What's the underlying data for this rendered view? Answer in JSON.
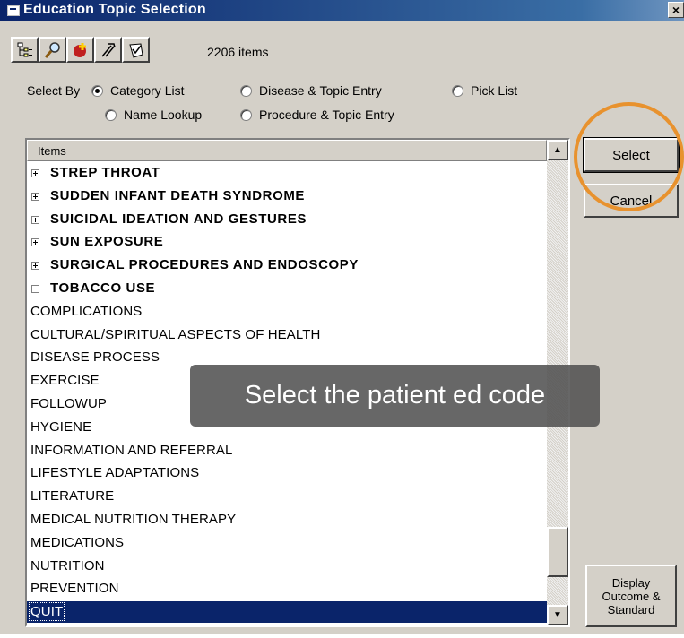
{
  "window": {
    "title": "Education Topic Selection",
    "close_label": "×"
  },
  "toolbar": {
    "buttons": [
      "tree-view-icon",
      "search-icon",
      "add-icon",
      "tools-icon",
      "checklist-icon"
    ],
    "item_count": "2206 items"
  },
  "select_by": {
    "label": "Select By",
    "options": [
      {
        "label": "Category List",
        "selected": true
      },
      {
        "label": "Disease & Topic Entry",
        "selected": false
      },
      {
        "label": "Pick List",
        "selected": false
      },
      {
        "label": "Name Lookup",
        "selected": false
      },
      {
        "label": "Procedure & Topic Entry",
        "selected": false
      }
    ]
  },
  "list": {
    "header": "Items",
    "rows": [
      {
        "label": "STREP THROAT",
        "type": "category",
        "expanded": false
      },
      {
        "label": "SUDDEN INFANT DEATH SYNDROME",
        "type": "category",
        "expanded": false
      },
      {
        "label": "SUICIDAL IDEATION AND GESTURES",
        "type": "category",
        "expanded": false
      },
      {
        "label": "SUN EXPOSURE",
        "type": "category",
        "expanded": false
      },
      {
        "label": "SURGICAL PROCEDURES AND ENDOSCOPY",
        "type": "category",
        "expanded": false
      },
      {
        "label": "TOBACCO USE",
        "type": "category",
        "expanded": true
      },
      {
        "label": "COMPLICATIONS",
        "type": "topic"
      },
      {
        "label": "CULTURAL/SPIRITUAL ASPECTS OF HEALTH",
        "type": "topic"
      },
      {
        "label": "DISEASE PROCESS",
        "type": "topic"
      },
      {
        "label": "EXERCISE",
        "type": "topic"
      },
      {
        "label": "FOLLOWUP",
        "type": "topic"
      },
      {
        "label": "HYGIENE",
        "type": "topic"
      },
      {
        "label": "INFORMATION AND REFERRAL",
        "type": "topic"
      },
      {
        "label": "LIFESTYLE ADAPTATIONS",
        "type": "topic"
      },
      {
        "label": "LITERATURE",
        "type": "topic"
      },
      {
        "label": "MEDICAL NUTRITION THERAPY",
        "type": "topic"
      },
      {
        "label": "MEDICATIONS",
        "type": "topic"
      },
      {
        "label": "NUTRITION",
        "type": "topic"
      },
      {
        "label": "PREVENTION",
        "type": "topic"
      },
      {
        "label": "QUIT",
        "type": "topic",
        "selected": true
      }
    ],
    "scroll_position": 0.93
  },
  "buttons": {
    "select": "Select",
    "cancel": "Cancel",
    "display_outcome": "Display Outcome & Standard"
  },
  "callout": {
    "text": "Select the patient ed code"
  },
  "colors": {
    "highlight_ring": "#e8922e",
    "selection": "#0a246a",
    "title_bar": "#0a246a"
  }
}
